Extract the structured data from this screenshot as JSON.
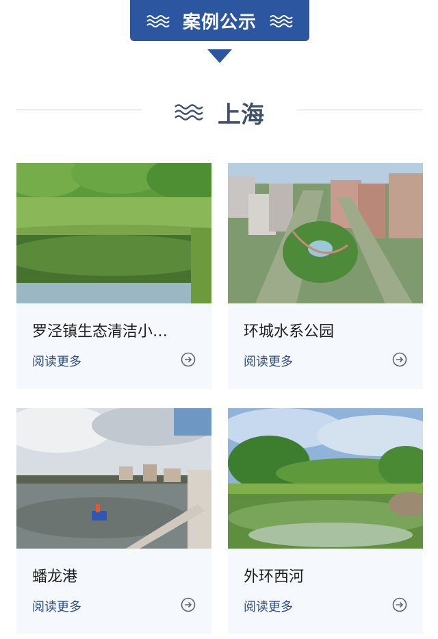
{
  "banner": {
    "title": "案例公示"
  },
  "section": {
    "title": "上海"
  },
  "cards": [
    {
      "title": "罗泾镇生态清洁小…",
      "read_more": "阅读更多",
      "image": "reed-pond-photo"
    },
    {
      "title": "环城水系公园",
      "read_more": "阅读更多",
      "image": "city-canal-park-aerial-photo"
    },
    {
      "title": "蟠龙港",
      "read_more": "阅读更多",
      "image": "river-boat-photo"
    },
    {
      "title": "外环西河",
      "read_more": "阅读更多",
      "image": "green-river-photo"
    }
  ],
  "colors": {
    "brand_blue": "#2c56a0",
    "card_bg": "#f5f8fc",
    "link_blue": "#2f4f86"
  },
  "icons": [
    "wave-icon",
    "arrow-circle-right-icon"
  ]
}
